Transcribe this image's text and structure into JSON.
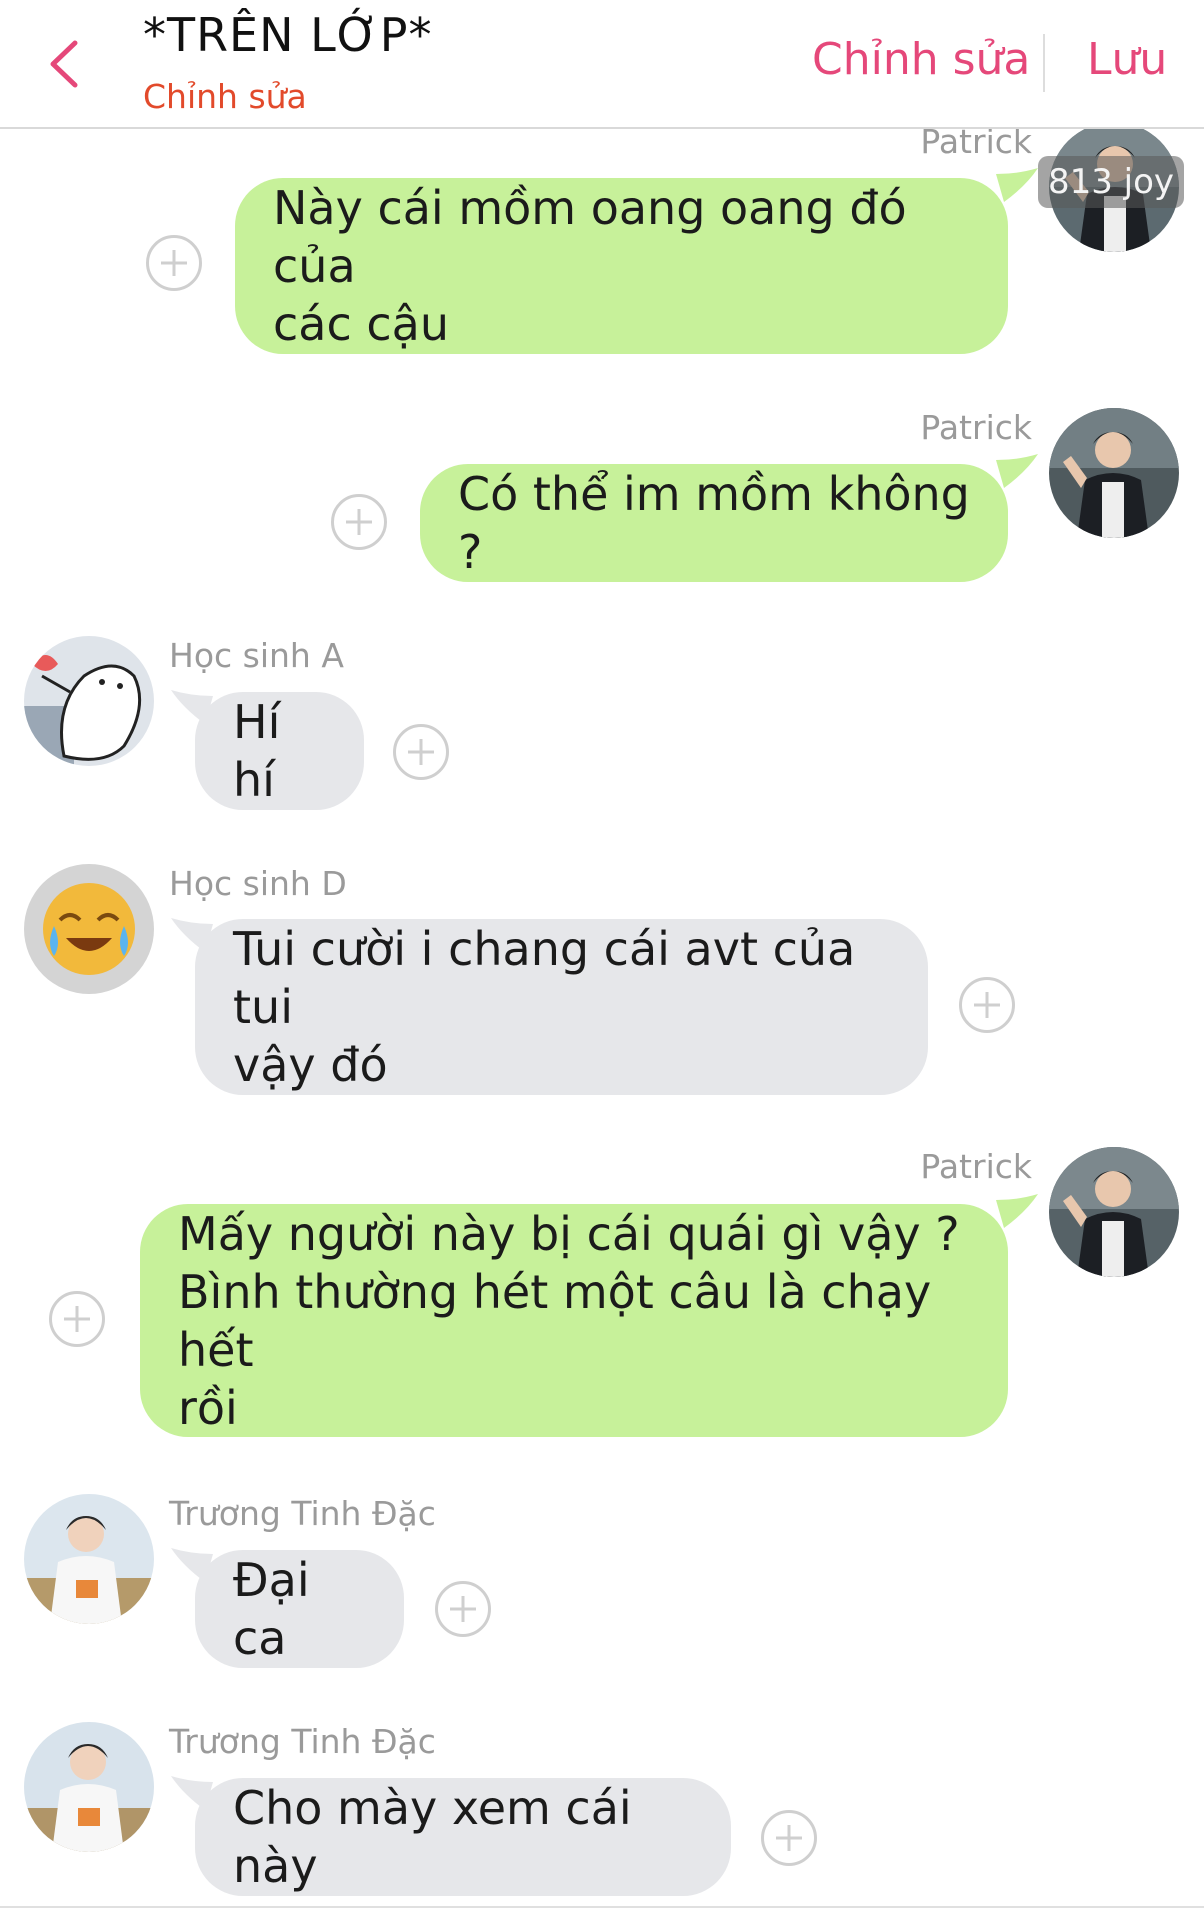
{
  "header": {
    "title": "*TRÊN LỚP*",
    "subtitle": "Chỉnh sửa",
    "edit_label": "Chỉnh sửa",
    "save_label": "Lưu"
  },
  "watermark": "813 joy",
  "messages": [
    {
      "sender": "Patrick",
      "text": "Này cái mồm oang oang đó của\ncác cậu",
      "side": "out"
    },
    {
      "sender": "Patrick",
      "text": "Có thể im mồm không ?",
      "side": "out"
    },
    {
      "sender": "Học sinh A",
      "text": "Hí hí",
      "side": "in"
    },
    {
      "sender": "Học sinh D",
      "text": "Tui cười i chang cái avt của tui\nvậy đó",
      "side": "in"
    },
    {
      "sender": "Patrick",
      "text": "Mấy người này bị cái quái gì vậy ?\nBình thường hét một câu là chạy hết\nrồi",
      "side": "out"
    },
    {
      "sender": "Trương Tinh Đặc",
      "text": "Đại ca",
      "side": "in"
    },
    {
      "sender": "Trương Tinh Đặc",
      "text": "Cho mày xem cái này",
      "side": "in"
    }
  ],
  "colors": {
    "accent": "#e5487a",
    "subtitle": "#e24a2b",
    "outgoing_bubble": "#c7f19a",
    "incoming_bubble": "#e6e7ea"
  }
}
